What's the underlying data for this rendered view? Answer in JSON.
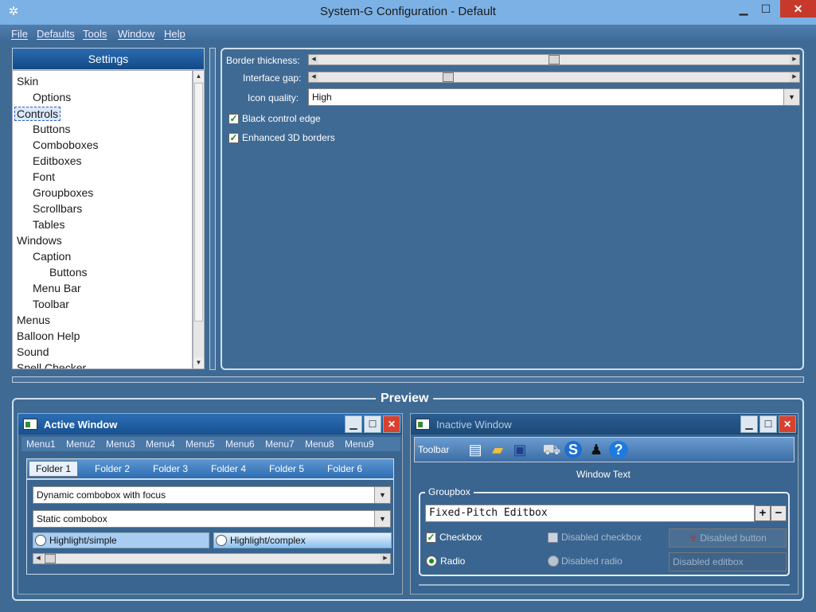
{
  "window": {
    "title": "System-G Configuration - Default",
    "minimize": "▁",
    "maximize": "☐",
    "close": "✕"
  },
  "menubar": [
    "File",
    "Defaults",
    "Tools",
    "Window",
    "Help"
  ],
  "settings": {
    "header": "Settings",
    "tree": [
      {
        "label": "Skin",
        "level": 0
      },
      {
        "label": "Options",
        "level": 1
      },
      {
        "label": "Controls",
        "level": 0,
        "selected": true
      },
      {
        "label": "Buttons",
        "level": 1
      },
      {
        "label": "Comboboxes",
        "level": 1
      },
      {
        "label": "Editboxes",
        "level": 1
      },
      {
        "label": "Font",
        "level": 1
      },
      {
        "label": "Groupboxes",
        "level": 1
      },
      {
        "label": "Scrollbars",
        "level": 1
      },
      {
        "label": "Tables",
        "level": 1
      },
      {
        "label": "Windows",
        "level": 0
      },
      {
        "label": "Caption",
        "level": 1
      },
      {
        "label": "Buttons",
        "level": 2
      },
      {
        "label": "Menu Bar",
        "level": 1
      },
      {
        "label": "Toolbar",
        "level": 1
      },
      {
        "label": "Menus",
        "level": 0
      },
      {
        "label": "Balloon Help",
        "level": 0
      },
      {
        "label": "Sound",
        "level": 0
      },
      {
        "label": "Spell Checker",
        "level": 0
      }
    ]
  },
  "options": {
    "border_thickness_label": "Border thickness:",
    "border_thickness_level": 0.5,
    "interface_gap_label": "Interface gap:",
    "interface_gap_level": 0.27,
    "icon_quality_label": "Icon quality:",
    "icon_quality_value": "High",
    "black_edge_label": "Black control edge",
    "black_edge_checked": true,
    "enhanced_3d_label": "Enhanced 3D borders",
    "enhanced_3d_checked": true
  },
  "preview": {
    "title": "Preview",
    "active": {
      "title": "Active Window",
      "menus": [
        "Menu1",
        "Menu2",
        "Menu3",
        "Menu4",
        "Menu5",
        "Menu6",
        "Menu7",
        "Menu8",
        "Menu9"
      ],
      "tabs": [
        "Folder 1",
        "Folder 2",
        "Folder 3",
        "Folder 4",
        "Folder 5",
        "Folder 6"
      ],
      "combo_focus": "Dynamic combobox with focus",
      "combo_static": "Static combobox",
      "radio_simple": "Highlight/simple",
      "radio_complex": "Highlight/complex"
    },
    "inactive": {
      "title": "Inactive Window",
      "toolbar_label": "Toolbar",
      "window_text": "Window Text",
      "groupbox_label": "Groupbox",
      "editbox_value": "Fixed-Pitch Editbox",
      "checkbox_label": "Checkbox",
      "radio_label": "Radio",
      "disabled_checkbox": "Disabled checkbox",
      "disabled_radio": "Disabled radio",
      "disabled_button": "Disabled button",
      "disabled_editbox": "Disabled editbox"
    }
  },
  "colors": {
    "background": "#3f6a94",
    "titlebar": "#7cb1e5",
    "accent": "#17508f",
    "close": "#c7392b",
    "check": "#1a8a1a"
  }
}
